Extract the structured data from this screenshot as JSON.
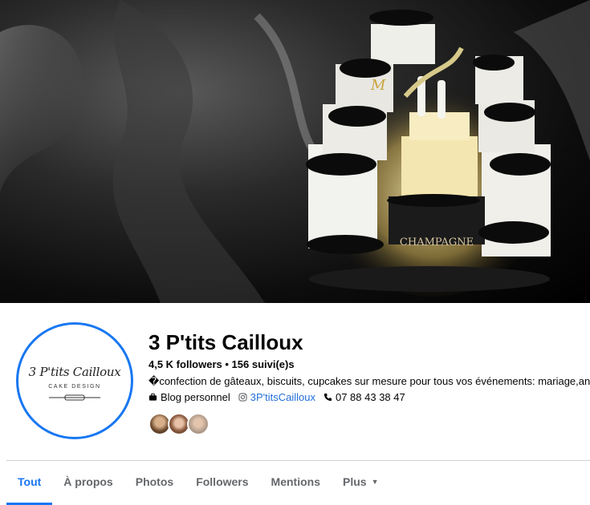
{
  "page": {
    "name": "3 P'tits Cailloux",
    "followers": "4,5 K followers",
    "following": "156 suivi(e)s",
    "stats_separator": " • ",
    "bio": "�confection de gâteaux, biscuits, cupcakes sur mesure pour tous vos événements: mariage,anniversaire",
    "category": "Blog personnel",
    "instagram": "3P'titsCailloux",
    "phone": "07 88 43 38 47"
  },
  "logo": {
    "script": "3 P'tits Cailloux",
    "subtitle": "CAKE DESIGN"
  },
  "cover": {
    "banner_text": "CHAMPAGNE",
    "monogram": "M"
  },
  "tabs": [
    {
      "label": "Tout",
      "active": true
    },
    {
      "label": "À propos",
      "active": false
    },
    {
      "label": "Photos",
      "active": false
    },
    {
      "label": "Followers",
      "active": false
    },
    {
      "label": "Mentions",
      "active": false
    },
    {
      "label": "Plus",
      "active": false
    }
  ],
  "colors": {
    "accent": "#1877f2",
    "link": "#216fdb",
    "muted": "#65676b"
  },
  "icons": {
    "category": "briefcase-icon",
    "instagram": "instagram-icon",
    "phone": "phone-icon",
    "more": "caret-down-icon"
  }
}
